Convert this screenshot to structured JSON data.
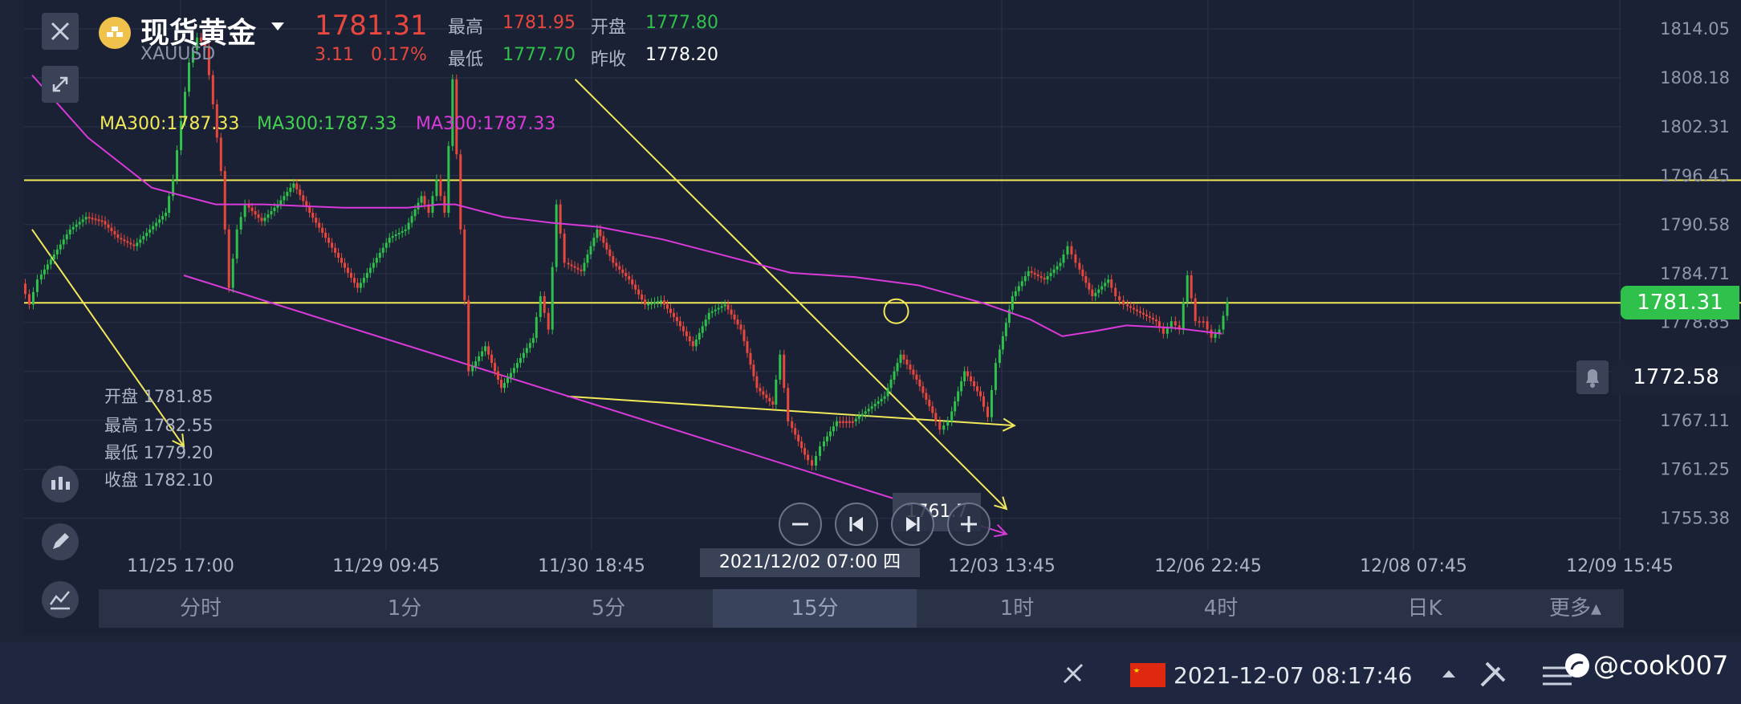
{
  "header": {
    "name": "现货黄金",
    "symbol": "XAUUSD",
    "price": "1781.31",
    "change": "3.11",
    "change_pct": "0.17%",
    "high_label": "最高",
    "high_value": "1781.95",
    "open_label": "开盘",
    "open_value": "1777.80",
    "low_label": "最低",
    "low_value": "1777.70",
    "prev_close_label": "昨收",
    "prev_close_value": "1778.20"
  },
  "ma_labels": [
    {
      "text": "MA300:1787.33",
      "color": "#f1e85a"
    },
    {
      "text": "MA300:1787.33",
      "color": "#43d14f"
    },
    {
      "text": "MA300:1787.33",
      "color": "#d93ad9"
    }
  ],
  "ohlc_box": {
    "open": "开盘  1781.85",
    "high": "最高  1782.55",
    "low": "最低  1779.20",
    "close": "收盘  1782.10"
  },
  "price_tag": "1781.31",
  "alert_price": "1772.58",
  "crosshair": {
    "date": "2021/12/02 07:00 四",
    "value": "1761.7"
  },
  "tabs": [
    "分时",
    "1分",
    "5分",
    "15分",
    "1时",
    "4时",
    "日K",
    "更多▴"
  ],
  "active_tab": "15分",
  "status_bar": {
    "datetime": "2021-12-07 08:17:46",
    "watermark": "@cook007"
  },
  "colors": {
    "background": "#1c2336",
    "up": "#2fc14b",
    "down": "#e8473e",
    "trendline": "#f1e85a",
    "ma": "#d93ad9"
  },
  "chart_data": {
    "type": "line",
    "title": "现货黄金 XAUUSD 15分",
    "y_ticks": [
      "1814.05",
      "1808.18",
      "1802.31",
      "1796.45",
      "1790.58",
      "1784.71",
      "1778.85",
      "1772.98",
      "1767.11",
      "1761.25",
      "1755.38"
    ],
    "ylim": [
      1751.5,
      1817.5
    ],
    "x_ticks": [
      "11/25 17:00",
      "11/29 09:45",
      "11/30 18:45",
      "12/03 13:45",
      "12/06 22:45",
      "12/08 07:45",
      "12/09 15:45"
    ],
    "series": [
      {
        "name": "price",
        "color": "#35b54a",
        "points": [
          [
            0,
            1783.5
          ],
          [
            0.005,
            1781
          ],
          [
            0.01,
            1784
          ],
          [
            0.02,
            1787
          ],
          [
            0.03,
            1790
          ],
          [
            0.04,
            1791.5
          ],
          [
            0.05,
            1791
          ],
          [
            0.06,
            1789
          ],
          [
            0.07,
            1788
          ],
          [
            0.08,
            1790
          ],
          [
            0.09,
            1792
          ],
          [
            0.095,
            1796
          ],
          [
            0.1,
            1803
          ],
          [
            0.105,
            1810
          ],
          [
            0.11,
            1813
          ],
          [
            0.115,
            1812
          ],
          [
            0.12,
            1805
          ],
          [
            0.125,
            1797
          ],
          [
            0.13,
            1783
          ],
          [
            0.135,
            1790
          ],
          [
            0.14,
            1793
          ],
          [
            0.15,
            1791
          ],
          [
            0.16,
            1793
          ],
          [
            0.17,
            1795.5
          ],
          [
            0.18,
            1792
          ],
          [
            0.19,
            1789
          ],
          [
            0.2,
            1786
          ],
          [
            0.21,
            1783
          ],
          [
            0.22,
            1786
          ],
          [
            0.23,
            1789
          ],
          [
            0.24,
            1790
          ],
          [
            0.25,
            1794
          ],
          [
            0.255,
            1792
          ],
          [
            0.26,
            1796
          ],
          [
            0.265,
            1792
          ],
          [
            0.27,
            1808
          ],
          [
            0.275,
            1790
          ],
          [
            0.28,
            1773
          ],
          [
            0.29,
            1776
          ],
          [
            0.3,
            1771
          ],
          [
            0.31,
            1774
          ],
          [
            0.32,
            1777
          ],
          [
            0.325,
            1782
          ],
          [
            0.33,
            1778
          ],
          [
            0.335,
            1793
          ],
          [
            0.34,
            1786
          ],
          [
            0.35,
            1785
          ],
          [
            0.36,
            1790
          ],
          [
            0.37,
            1786
          ],
          [
            0.38,
            1784
          ],
          [
            0.39,
            1781
          ],
          [
            0.4,
            1781.5
          ],
          [
            0.41,
            1779
          ],
          [
            0.42,
            1776
          ],
          [
            0.43,
            1780
          ],
          [
            0.44,
            1781
          ],
          [
            0.45,
            1778
          ],
          [
            0.46,
            1771
          ],
          [
            0.47,
            1769
          ],
          [
            0.475,
            1775
          ],
          [
            0.48,
            1767
          ],
          [
            0.49,
            1763
          ],
          [
            0.495,
            1761.7
          ],
          [
            0.5,
            1764
          ],
          [
            0.51,
            1767
          ],
          [
            0.52,
            1767
          ],
          [
            0.53,
            1768.5
          ],
          [
            0.54,
            1770
          ],
          [
            0.55,
            1775
          ],
          [
            0.56,
            1772
          ],
          [
            0.57,
            1768
          ],
          [
            0.575,
            1766
          ],
          [
            0.58,
            1767
          ],
          [
            0.59,
            1773
          ],
          [
            0.6,
            1770
          ],
          [
            0.605,
            1767.5
          ],
          [
            0.61,
            1774
          ],
          [
            0.62,
            1782
          ],
          [
            0.63,
            1785
          ],
          [
            0.64,
            1784
          ],
          [
            0.65,
            1786
          ],
          [
            0.655,
            1788
          ],
          [
            0.66,
            1786
          ],
          [
            0.67,
            1782
          ],
          [
            0.68,
            1784
          ],
          [
            0.685,
            1782
          ],
          [
            0.69,
            1781
          ],
          [
            0.7,
            1780
          ],
          [
            0.71,
            1779
          ],
          [
            0.715,
            1777.5
          ],
          [
            0.72,
            1779
          ],
          [
            0.725,
            1778
          ],
          [
            0.73,
            1784.5
          ],
          [
            0.735,
            1779
          ],
          [
            0.74,
            1779
          ],
          [
            0.745,
            1777
          ],
          [
            0.75,
            1778
          ],
          [
            0.755,
            1781.3
          ]
        ]
      },
      {
        "name": "MA300",
        "color": "#d93ad9",
        "points": [
          [
            0.005,
            1808.5
          ],
          [
            0.04,
            1801
          ],
          [
            0.08,
            1795
          ],
          [
            0.12,
            1793
          ],
          [
            0.15,
            1793
          ],
          [
            0.2,
            1792.6
          ],
          [
            0.24,
            1792.6
          ],
          [
            0.26,
            1793
          ],
          [
            0.27,
            1793
          ],
          [
            0.3,
            1791.5
          ],
          [
            0.33,
            1790.8
          ],
          [
            0.36,
            1790.3
          ],
          [
            0.4,
            1788.8
          ],
          [
            0.44,
            1786.8
          ],
          [
            0.48,
            1784.8
          ],
          [
            0.52,
            1784.3
          ],
          [
            0.56,
            1783.3
          ],
          [
            0.6,
            1781.2
          ],
          [
            0.63,
            1779.2
          ],
          [
            0.65,
            1777.2
          ],
          [
            0.67,
            1777.8
          ],
          [
            0.69,
            1778.5
          ],
          [
            0.72,
            1778.2
          ],
          [
            0.75,
            1777.5
          ]
        ]
      }
    ],
    "annotations": [
      {
        "type": "hline",
        "y": 1795.9,
        "color": "#f1e85a"
      },
      {
        "type": "hline",
        "y": 1781.2,
        "color": "#f1e85a"
      },
      {
        "type": "segment",
        "from": [
          0.345,
          1808
        ],
        "to": [
          0.615,
          1756.5
        ],
        "color": "#f1e85a",
        "arrow": true
      },
      {
        "type": "segment",
        "from": [
          0.005,
          1790
        ],
        "to": [
          0.1,
          1764
        ],
        "color": "#f1e85a",
        "arrow": true
      },
      {
        "type": "segment",
        "from": [
          0.34,
          1770
        ],
        "to": [
          0.62,
          1766.5
        ],
        "color": "#f1e85a",
        "arrow": true
      },
      {
        "type": "segment",
        "from": [
          0.1,
          1784.5
        ],
        "to": [
          0.615,
          1753.5
        ],
        "color": "#d93ad9",
        "arrow": true
      },
      {
        "type": "circle",
        "at": [
          0.546,
          1780.2
        ],
        "color": "#f1e85a"
      }
    ]
  }
}
